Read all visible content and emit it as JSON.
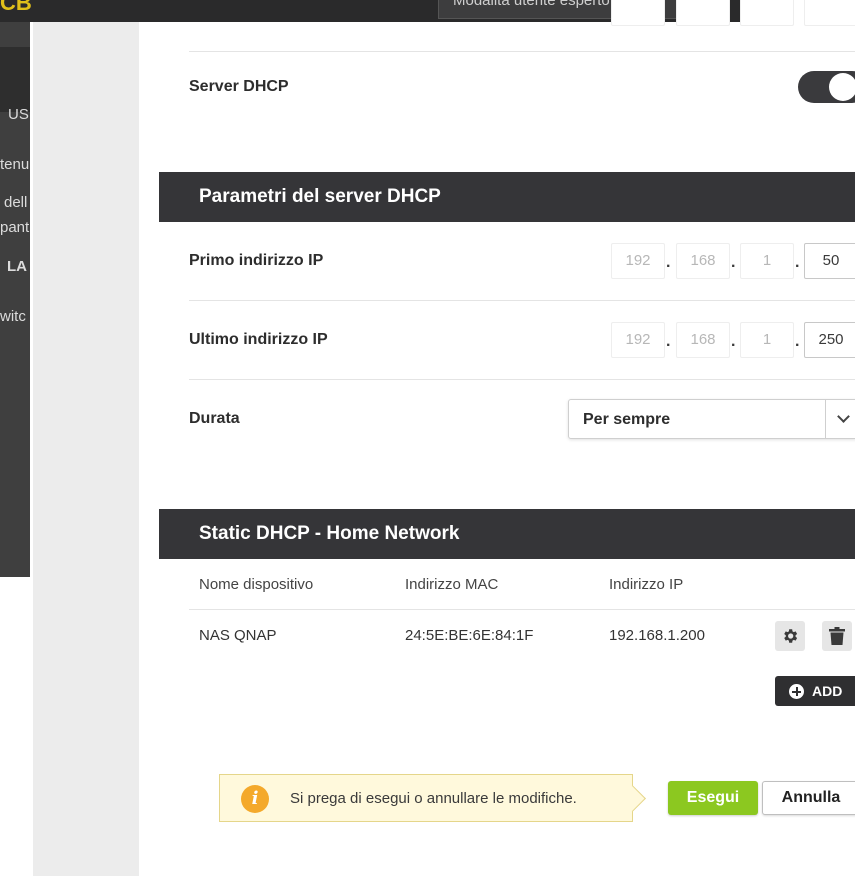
{
  "background_app": {
    "logo_fragment": "CB",
    "mode_select": "Modalità utente esperto",
    "side_fragments": [
      "US",
      "tenu",
      "dell",
      "pant",
      "LA",
      "witc"
    ]
  },
  "dhcp": {
    "server_label": "Server DHCP",
    "server_enabled": true
  },
  "params": {
    "title": "Parametri del server DHCP",
    "first_ip_label": "Primo indirizzo IP",
    "first_ip": [
      "192",
      "168",
      "1",
      "50"
    ],
    "last_ip_label": "Ultimo indirizzo IP",
    "last_ip": [
      "192",
      "168",
      "1",
      "250"
    ],
    "ip_separator": ".",
    "duration_label": "Durata",
    "duration_value": "Per sempre"
  },
  "static": {
    "title": "Static DHCP - Home Network",
    "headers": [
      "Nome dispositivo",
      "Indirizzo MAC",
      "Indirizzo IP"
    ],
    "rows": [
      {
        "name": "NAS QNAP",
        "mac": "24:5E:BE:6E:84:1F",
        "ip": "192.168.1.200"
      }
    ],
    "add_label": "ADD"
  },
  "footer": {
    "info_glyph": "i",
    "notice": "Si prega di esegui o annullare le modifiche.",
    "execute_label": "Esegui",
    "cancel_label": "Annulla"
  },
  "colors": {
    "accent_green": "#8cc820",
    "header_dark": "#353538",
    "info_orange": "#f4a92b"
  }
}
